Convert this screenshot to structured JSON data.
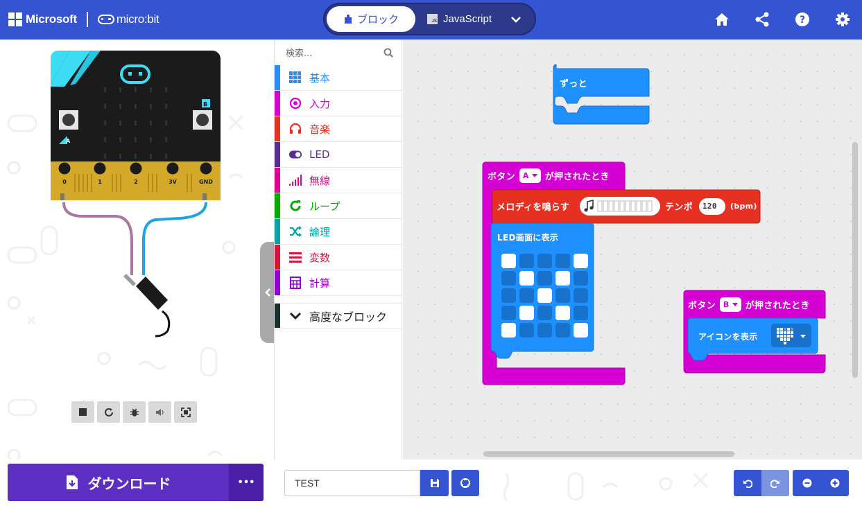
{
  "header": {
    "brand_microsoft": "Microsoft",
    "brand_microbit": "micro:bit",
    "tab_blocks": "ブロック",
    "tab_javascript": "JavaScript",
    "js_badge": "JS"
  },
  "simulator": {
    "pins": [
      "0",
      "1",
      "2",
      "3V",
      "GND"
    ],
    "button_a": "A",
    "button_b": "B"
  },
  "toolbox": {
    "search_placeholder": "検索...",
    "categories": [
      {
        "label": "基本",
        "color": "#1e90ff",
        "icon": "grid-icon"
      },
      {
        "label": "入力",
        "color": "#d400d4",
        "icon": "target-icon"
      },
      {
        "label": "音楽",
        "color": "#e63022",
        "icon": "headphones-icon"
      },
      {
        "label": "LED",
        "color": "#5c2d91",
        "icon": "toggle-icon"
      },
      {
        "label": "無線",
        "color": "#e3008c",
        "icon": "signal-bars-icon"
      },
      {
        "label": "ループ",
        "color": "#00aa00",
        "icon": "refresh-icon"
      },
      {
        "label": "論理",
        "color": "#00a4a6",
        "icon": "shuffle-icon"
      },
      {
        "label": "変数",
        "color": "#dc143c",
        "icon": "list-icon"
      },
      {
        "label": "計算",
        "color": "#9400d3",
        "icon": "calculator-icon"
      }
    ],
    "advanced": "高度なブロック"
  },
  "workspace": {
    "forever_label": "ずっと",
    "button_a_block": {
      "prefix": "ボタン",
      "button": "A",
      "suffix": "が押されたとき"
    },
    "melody_block": {
      "label": "メロディを鳴らす",
      "tempo_label": "テンポ",
      "tempo_value": "120",
      "unit": "(bpm)"
    },
    "show_leds_label": "LED画面に表示",
    "led_pattern": [
      [
        1,
        0,
        0,
        0,
        1
      ],
      [
        0,
        1,
        0,
        1,
        0
      ],
      [
        0,
        0,
        1,
        0,
        0
      ],
      [
        0,
        1,
        0,
        1,
        0
      ],
      [
        1,
        0,
        0,
        0,
        1
      ]
    ],
    "button_b_block": {
      "prefix": "ボタン",
      "button": "B",
      "suffix": "が押されたとき"
    },
    "show_icon_label": "アイコンを表示",
    "block_colors": {
      "basic": "#1e90ff",
      "input": "#d400d4",
      "music": "#e63022"
    }
  },
  "bottom": {
    "download_label": "ダウンロード",
    "more_label": "•••",
    "project_name": "TEST"
  }
}
